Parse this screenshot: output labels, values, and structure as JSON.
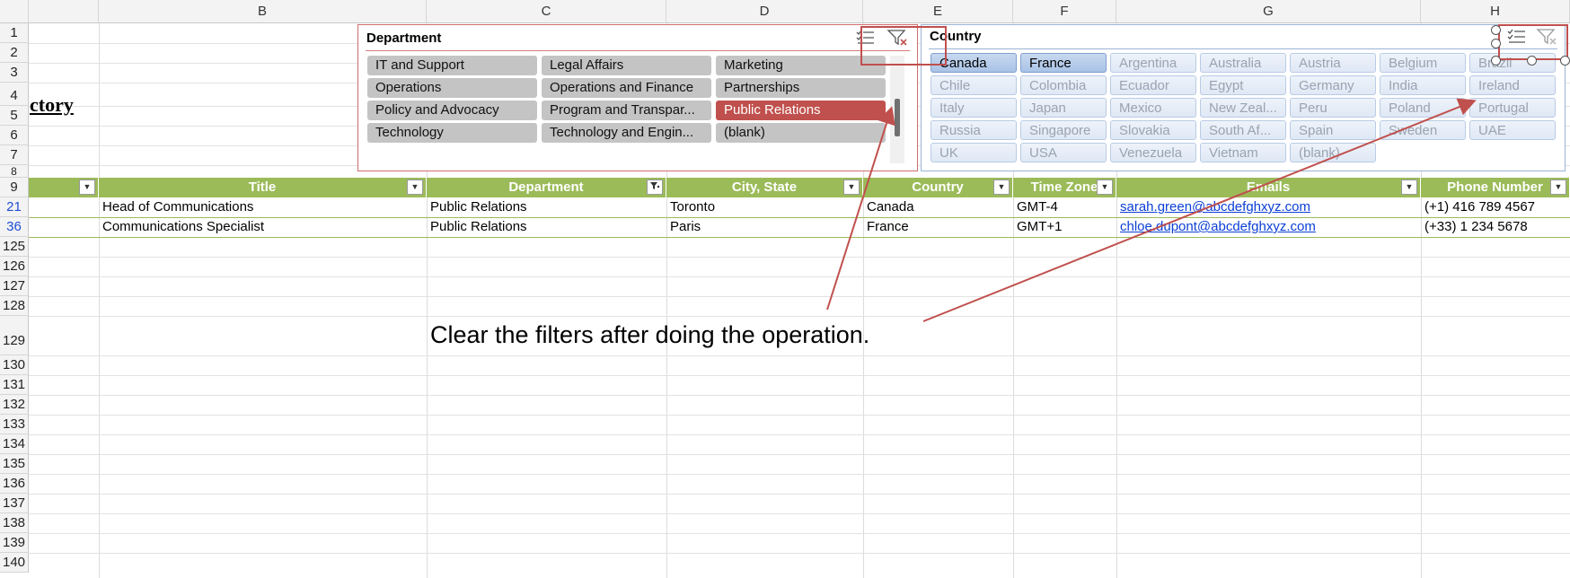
{
  "columns": [
    "B",
    "C",
    "D",
    "E",
    "F",
    "G",
    "H"
  ],
  "rows": {
    "top": [
      "1",
      "2",
      "3",
      "4",
      "5",
      "6",
      "7",
      "8",
      "9"
    ],
    "data": [
      "21",
      "36"
    ],
    "bottom": [
      "125",
      "126",
      "127",
      "128",
      "129",
      "130",
      "131",
      "132",
      "133",
      "134",
      "135",
      "136",
      "137",
      "138",
      "139",
      "140"
    ]
  },
  "sheet_title": "ctory",
  "table": {
    "headers": [
      "Title",
      "Department",
      "City, State",
      "Country",
      "Time Zone",
      "Emails",
      "Phone Number"
    ],
    "rows": [
      [
        "Head of Communications",
        "Public Relations",
        "Toronto",
        "Canada",
        "GMT-4",
        "sarah.green@abcdefghxyz.com",
        "(+1) 416 789 4567"
      ],
      [
        "Communications Specialist",
        "Public Relations",
        "Paris",
        "France",
        "GMT+1",
        "chloe.dupont@abcdefghxyz.com",
        "(+33) 1 234 5678"
      ]
    ]
  },
  "dept_slicer": {
    "title": "Department",
    "items": [
      "IT and Support",
      "Legal Affairs",
      "Marketing",
      "Operations",
      "Operations and Finance",
      "Partnerships",
      "Policy and Advocacy",
      "Program and Transpar...",
      "Public Relations",
      "Technology",
      "Technology and Engin...",
      "(blank)"
    ],
    "selected": "Public Relations",
    "multiselect_icon": "multi-select-icon",
    "clear_icon": "clear-filter-icon"
  },
  "country_slicer": {
    "title": "Country",
    "items": [
      "Canada",
      "France",
      "Argentina",
      "Australia",
      "Austria",
      "Belgium",
      "Brazil",
      "Chile",
      "Colombia",
      "Ecuador",
      "Egypt",
      "Germany",
      "India",
      "Ireland",
      "Italy",
      "Japan",
      "Mexico",
      "New Zeal...",
      "Peru",
      "Poland",
      "Portugal",
      "Russia",
      "Singapore",
      "Slovakia",
      "South Af...",
      "Spain",
      "Sweden",
      "UAE",
      "UK",
      "USA",
      "Venezuela",
      "Vietnam",
      "(blank)"
    ],
    "selected": [
      "Canada",
      "France"
    ],
    "multiselect_icon": "multi-select-icon",
    "clear_icon": "clear-filter-icon"
  },
  "annotation": "Clear the filters after doing the operation.",
  "colors": {
    "header_green": "#9bbb59",
    "dept_selected": "#c0504d",
    "annotation_red": "#c0504d",
    "link_blue": "#0b3fd6"
  }
}
